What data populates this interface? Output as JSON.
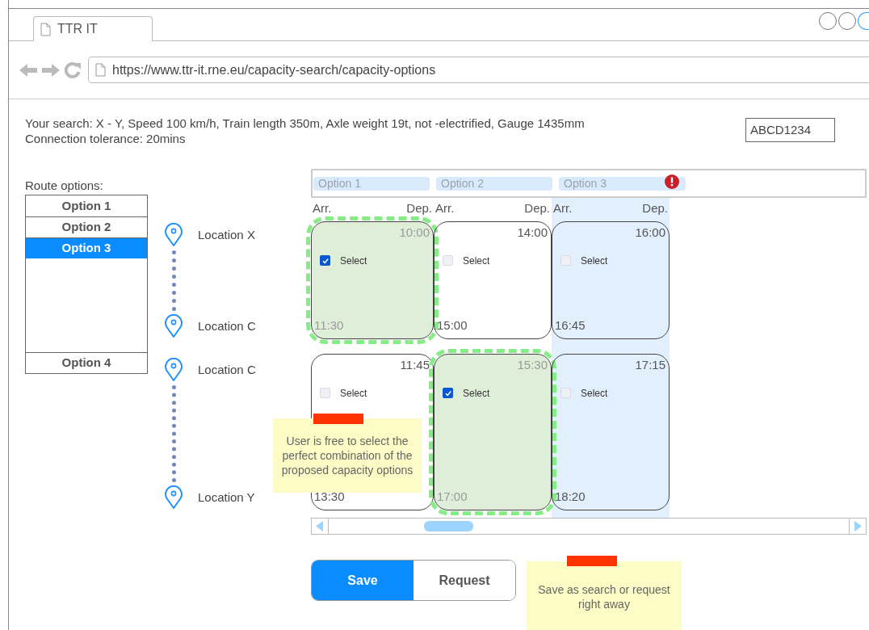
{
  "browser": {
    "tab_title": "TTR IT",
    "url": "https://www.ttr-it.rne.eu/capacity-search/capacity-options"
  },
  "search_summary": [
    "Your search: X - Y, Speed 100 km/h, Train length 350m, Axle weight 19t, not -electrified, Gauge 1435mm",
    "Connection tolerance: 20mins"
  ],
  "reference_field": {
    "value": "ABCD1234"
  },
  "route_options": {
    "label": "Route options:",
    "items": [
      {
        "label": "Option 1",
        "selected": false
      },
      {
        "label": "Option 2",
        "selected": false
      },
      {
        "label": "Option 3",
        "selected": true
      },
      {
        "label": "Option 4",
        "selected": false
      }
    ]
  },
  "columns": [
    {
      "label": "Option 1",
      "arr": "Arr.",
      "dep": "Dep.",
      "selected": false,
      "warning": false
    },
    {
      "label": "Option 2",
      "arr": "Arr.",
      "dep": "Dep.",
      "selected": false,
      "warning": false
    },
    {
      "label": "Option 3",
      "arr": "Arr.",
      "dep": "Dep.",
      "selected": true,
      "warning": true
    }
  ],
  "segments": [
    {
      "from": "Location X",
      "to": "Location C",
      "cards": [
        {
          "departure": "10:00",
          "arrival": "11:30",
          "select_label": "Select",
          "checked": true
        },
        {
          "departure": "14:00",
          "arrival": "15:00",
          "select_label": "Select",
          "checked": false
        },
        {
          "departure": "16:00",
          "arrival": "16:45",
          "select_label": "Select",
          "checked": false
        }
      ]
    },
    {
      "from": "Location C",
      "to": "Location Y",
      "cards": [
        {
          "departure": "11:45",
          "arrival": "13:30",
          "select_label": "Select",
          "checked": false
        },
        {
          "departure": "15:30",
          "arrival": "17:00",
          "select_label": "Select",
          "checked": true
        },
        {
          "departure": "17:15",
          "arrival": "18:20",
          "select_label": "Select",
          "checked": false
        }
      ]
    }
  ],
  "buttons": [
    {
      "label": "Save",
      "selected": true
    },
    {
      "label": "Request",
      "selected": false
    }
  ],
  "notes": [
    "User is free to select the perfect combination of the proposed capacity options",
    "Save as search or request right away"
  ]
}
